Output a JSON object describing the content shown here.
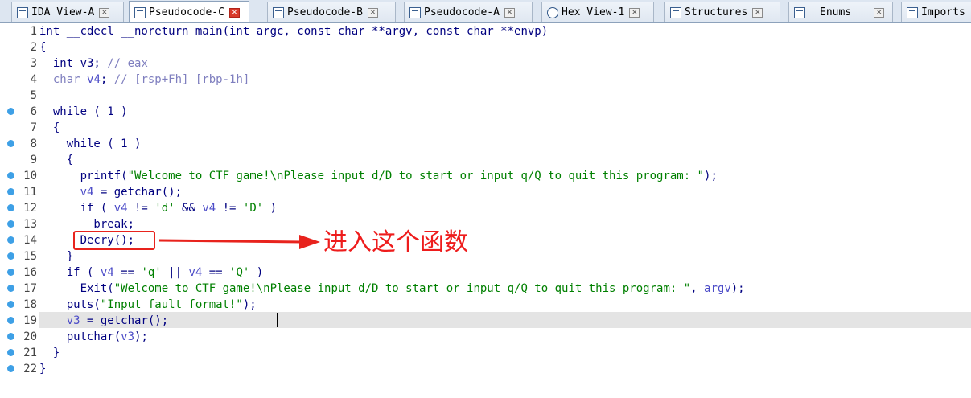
{
  "tabs": [
    {
      "label": "IDA View-A",
      "active": false,
      "icon": "ida-view-icon"
    },
    {
      "label": "Pseudocode-C",
      "active": true,
      "icon": "pseudocode-icon"
    },
    {
      "label": "Pseudocode-B",
      "active": false,
      "icon": "pseudocode-icon"
    },
    {
      "label": "Pseudocode-A",
      "active": false,
      "icon": "pseudocode-icon"
    },
    {
      "label": "Hex View-1",
      "active": false,
      "icon": "hex-view-icon"
    },
    {
      "label": "Structures",
      "active": false,
      "icon": "structures-icon"
    },
    {
      "label": "Enums",
      "active": false,
      "icon": "enums-icon"
    },
    {
      "label": "Imports",
      "active": false,
      "icon": "imports-icon"
    }
  ],
  "close_glyph": "×",
  "code_lines": [
    {
      "n": "1",
      "bp": false
    },
    {
      "n": "2",
      "bp": false
    },
    {
      "n": "3",
      "bp": false
    },
    {
      "n": "4",
      "bp": false
    },
    {
      "n": "5",
      "bp": false
    },
    {
      "n": "6",
      "bp": true
    },
    {
      "n": "7",
      "bp": false
    },
    {
      "n": "8",
      "bp": true
    },
    {
      "n": "9",
      "bp": false
    },
    {
      "n": "10",
      "bp": true
    },
    {
      "n": "11",
      "bp": true
    },
    {
      "n": "12",
      "bp": true
    },
    {
      "n": "13",
      "bp": true
    },
    {
      "n": "14",
      "bp": true
    },
    {
      "n": "15",
      "bp": true
    },
    {
      "n": "16",
      "bp": true
    },
    {
      "n": "17",
      "bp": true
    },
    {
      "n": "18",
      "bp": true
    },
    {
      "n": "19",
      "bp": true
    },
    {
      "n": "20",
      "bp": true
    },
    {
      "n": "21",
      "bp": true
    },
    {
      "n": "22",
      "bp": true
    }
  ],
  "code": {
    "l1": "int __cdecl __noreturn main(int argc, const char **argv, const char **envp)",
    "l2": "{",
    "l3_kw": "  int v3; ",
    "l3_comment": "// eax",
    "l4_type": "  char ",
    "l4_var": "v4",
    "l4_semi": "; ",
    "l4_comment": "// [rsp+Fh] [rbp-1h]",
    "l5": "",
    "l6": "  while ( 1 )",
    "l7": "  {",
    "l8": "    while ( 1 )",
    "l9": "    {",
    "l10_fn": "      printf(",
    "l10_str": "\"Welcome to CTF game!\\nPlease input d/D to start or input q/Q to quit this program: \"",
    "l10_end": ");",
    "l11_var": "      v4",
    "l11_rest": " = getchar();",
    "l12_a": "      if ( ",
    "l12_v1": "v4",
    "l12_b": " != ",
    "l12_s1": "'d'",
    "l12_c": " && ",
    "l12_v2": "v4",
    "l12_d": " != ",
    "l12_s2": "'D'",
    "l12_e": " )",
    "l13": "        break;",
    "l14": "      Decry();",
    "l15": "    }",
    "l16_a": "    if ( ",
    "l16_v1": "v4",
    "l16_b": " == ",
    "l16_s1": "'q'",
    "l16_c": " || ",
    "l16_v2": "v4",
    "l16_d": " == ",
    "l16_s2": "'Q'",
    "l16_e": " )",
    "l17_fn": "      Exit(",
    "l17_str": "\"Welcome to CTF game!\\nPlease input d/D to start or input q/Q to quit this program: \"",
    "l17_mid": ", ",
    "l17_var": "argv",
    "l17_end": ");",
    "l18_fn": "    puts(",
    "l18_str": "\"Input fault format!\"",
    "l18_end": ");",
    "l19_var": "    v3",
    "l19_rest": " = getchar();",
    "l20_fn": "    putchar(",
    "l20_var": "v3",
    "l20_end": ");",
    "l21": "  }",
    "l22": "}"
  },
  "annotation": {
    "label": "进入这个函数",
    "color": "#ee1c1c"
  }
}
